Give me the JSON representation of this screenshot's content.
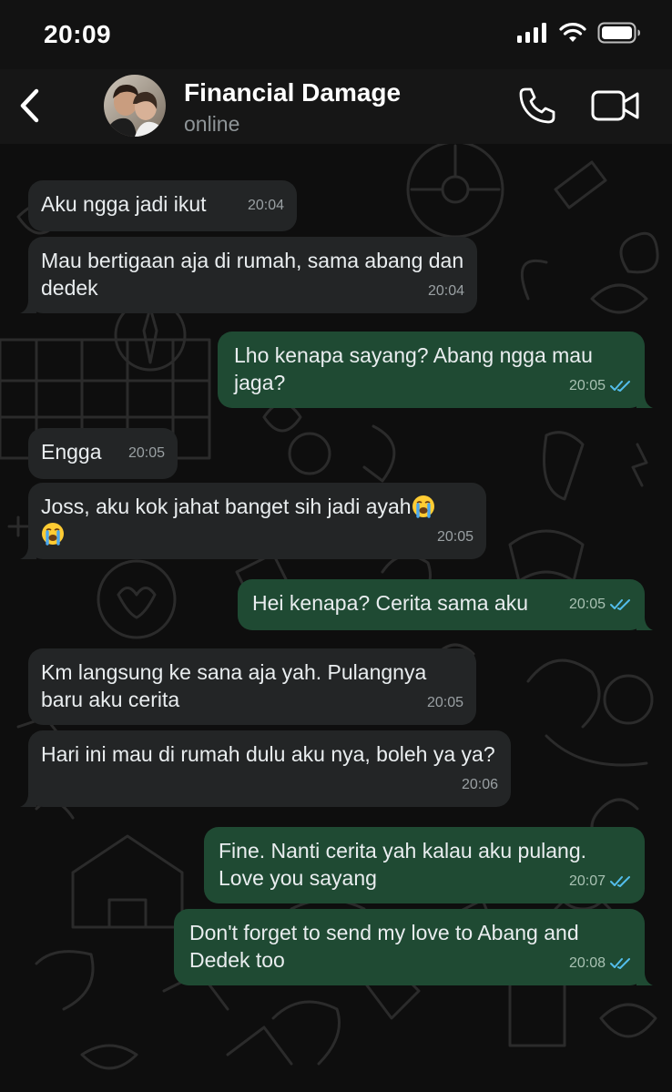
{
  "status_bar": {
    "time": "20:09",
    "icons": [
      "signal-icon",
      "wifi-icon",
      "battery-icon"
    ]
  },
  "header": {
    "back_icon": "chevron-left-icon",
    "contact_name": "Financial Damage",
    "contact_status": "online",
    "actions": [
      "phone-icon",
      "video-camera-icon"
    ]
  },
  "messages": [
    {
      "direction": "in",
      "text": "Aku ngga jadi ikut",
      "time": "20:04"
    },
    {
      "direction": "in",
      "text": "Mau bertigaan aja di rumah, sama abang dan dedek",
      "time": "20:04"
    },
    {
      "direction": "out",
      "text": "Lho kenapa sayang? Abang ngga mau jaga?",
      "time": "20:05",
      "read": true
    },
    {
      "direction": "in",
      "text": "Engga",
      "time": "20:05"
    },
    {
      "direction": "in",
      "text": "Joss, aku kok jahat banget sih jadi ayah",
      "emoji": "loudly-crying-face-icon",
      "time": "20:05"
    },
    {
      "direction": "out",
      "text": "Hei kenapa? Cerita sama aku",
      "time": "20:05",
      "read": true
    },
    {
      "direction": "in",
      "text": "Km langsung ke sana aja yah. Pulangnya baru aku cerita",
      "time": "20:05"
    },
    {
      "direction": "in",
      "text": "Hari ini mau di rumah dulu aku nya, boleh ya ya?",
      "time": "20:06"
    },
    {
      "direction": "out",
      "text": "Fine. Nanti cerita yah kalau aku pulang. Love you sayang",
      "time": "20:07",
      "read": true
    },
    {
      "direction": "out",
      "text": "Don't forget to send my love to Abang and Dedek too",
      "time": "20:08",
      "read": true
    }
  ],
  "colors": {
    "incoming_bubble": "#232526",
    "outgoing_bubble": "#1f4a33",
    "read_ticks": "#53bdeb",
    "background": "#0e0e0e"
  }
}
